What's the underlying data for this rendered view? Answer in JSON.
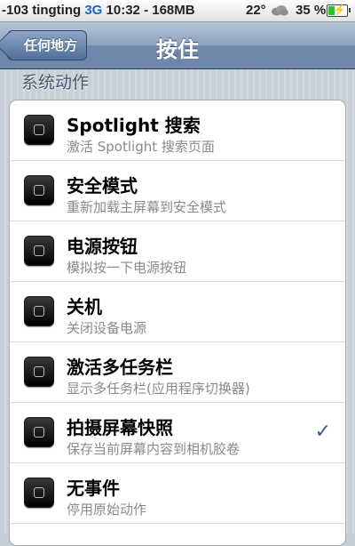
{
  "status_bar": {
    "carrier": "-103 tingting",
    "network": "3G",
    "time": "10:32",
    "separator": "-",
    "memory": "168MB",
    "temperature": "22°",
    "weather_icon": "cloud-icon",
    "battery_percent": "35 %",
    "battery_level": 0.35,
    "battery_color": "#2fbf2f"
  },
  "navbar": {
    "back_label": "任何地方",
    "title": "按住"
  },
  "section": {
    "header": "系统动作"
  },
  "actions": [
    {
      "title": "Spotlight 搜索",
      "subtitle": "激活 Spotlight 搜索页面",
      "selected": false
    },
    {
      "title": "安全模式",
      "subtitle": "重新加载主屏幕到安全模式",
      "selected": false
    },
    {
      "title": "电源按钮",
      "subtitle": "模拟按一下电源按钮",
      "selected": false
    },
    {
      "title": "关机",
      "subtitle": "关闭设备电源",
      "selected": false
    },
    {
      "title": "激活多任务栏",
      "subtitle": "显示多任务栏(应用程序切换器)",
      "selected": false
    },
    {
      "title": "拍摄屏幕快照",
      "subtitle": "保存当前屏幕内容到相机胶卷",
      "selected": true
    },
    {
      "title": "无事件",
      "subtitle": "停用原始动作",
      "selected": false
    }
  ],
  "check_mark": "✓",
  "colors": {
    "accent": "#3d5a8e",
    "network": "#1a63c6"
  }
}
